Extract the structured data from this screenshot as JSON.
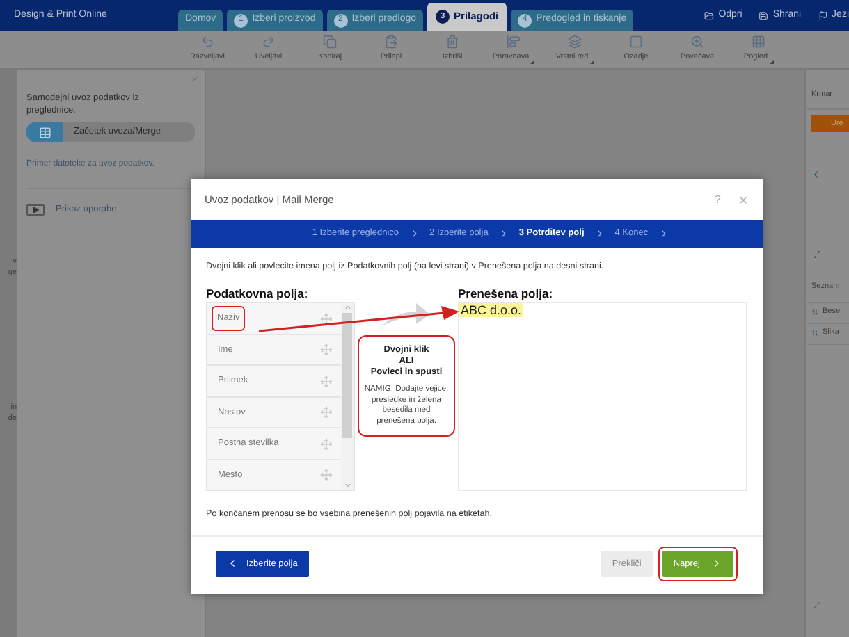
{
  "top_bar": {
    "app_title": "Design & Print Online",
    "tabs": [
      {
        "label": "Domov",
        "selected": false
      },
      {
        "number": "1",
        "label": "Izberi proizvod",
        "selected": false
      },
      {
        "number": "2",
        "label": "Izberi predlogo",
        "selected": false
      },
      {
        "number": "3",
        "label": "Prilagodi",
        "selected": true
      },
      {
        "number": "4",
        "label": "Predogled in tiskanje",
        "selected": false
      }
    ],
    "actions": [
      "Odpri",
      "Shrani",
      "Jezi"
    ]
  },
  "toolbar": [
    {
      "label": "Razveljavi",
      "dropdown": false
    },
    {
      "label": "Uveljavi",
      "dropdown": false
    },
    {
      "label": "Kopiraj",
      "dropdown": false
    },
    {
      "label": "Prilepi",
      "dropdown": false
    },
    {
      "label": "Izbriši",
      "dropdown": false
    },
    {
      "label": "Poravnava",
      "dropdown": true
    },
    {
      "label": "Vrstni red",
      "dropdown": true
    },
    {
      "label": "Ozadje",
      "dropdown": false
    },
    {
      "label": "Povečava",
      "dropdown": false
    },
    {
      "label": "Pogled",
      "dropdown": true
    }
  ],
  "left_strip": [
    "v",
    "ge",
    "in",
    "de"
  ],
  "left_panel": {
    "text": "Samodejni uvoz podatkov iz preglednice.",
    "button": "Začetek uvoza/Merge",
    "link": "Primer datoteke za uvoz podatkov.",
    "video_link": "Prikaz uporabe"
  },
  "right_panel": {
    "title": "Krmar",
    "button": "Ure",
    "list_title": "Seznam",
    "items": [
      "Bese",
      "Slika"
    ]
  },
  "dialog": {
    "title": "Uvoz podatkov | Mail Merge",
    "help": "?",
    "steps": [
      {
        "label": "1 Izberite preglednico",
        "selected": false
      },
      {
        "label": "2 Izberite polja",
        "selected": false
      },
      {
        "label": "3 Potrditev polj",
        "selected": true
      },
      {
        "label": "4 Konec",
        "selected": false
      }
    ],
    "instruction": "Dvojni klik ali povlecite imena polj iz Podatkovnih polj (na levi strani) v Prenešena polja na desni strani.",
    "fields_heading": "Podatkovna polja:",
    "fields": [
      {
        "label": "Naziv",
        "highlighted": true
      },
      {
        "label": "Ime",
        "highlighted": false
      },
      {
        "label": "Priimek",
        "highlighted": false
      },
      {
        "label": "Naslov",
        "highlighted": false
      },
      {
        "label": "Postna stevilka",
        "highlighted": false
      },
      {
        "label": "Mesto",
        "highlighted": false
      }
    ],
    "transferred_heading": "Prenešena polja:",
    "transferred": [
      "ABC d.o.o."
    ],
    "callout": {
      "lines": [
        "Dvojni klik",
        "ALI",
        "Povleci in spusti"
      ],
      "hint": "NAMIG: Dodajte vejice, presledke in želena besedila med prenešena polja."
    },
    "footer_note": "Po končanem prenosu se bo vsebina prenešenih polj pojavila na etiketah.",
    "back_button": "Izberite polja",
    "cancel_button": "Prekliči",
    "next_button": "Naprej"
  }
}
